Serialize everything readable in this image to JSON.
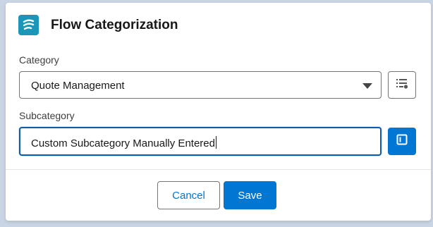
{
  "modal": {
    "title": "Flow Categorization",
    "app_icon": "flow-icon"
  },
  "category": {
    "label": "Category",
    "selected": "Quote Management",
    "picklist_button_icon": "picklist-icon"
  },
  "subcategory": {
    "label": "Subcategory",
    "value": "Custom Subcategory Manually Entered",
    "toggle_button_icon": "panel-icon"
  },
  "footer": {
    "cancel_label": "Cancel",
    "save_label": "Save"
  },
  "colors": {
    "brand": "#0176d3",
    "app_icon_bg": "#1b96b8",
    "focus_border": "#0b5cab"
  }
}
